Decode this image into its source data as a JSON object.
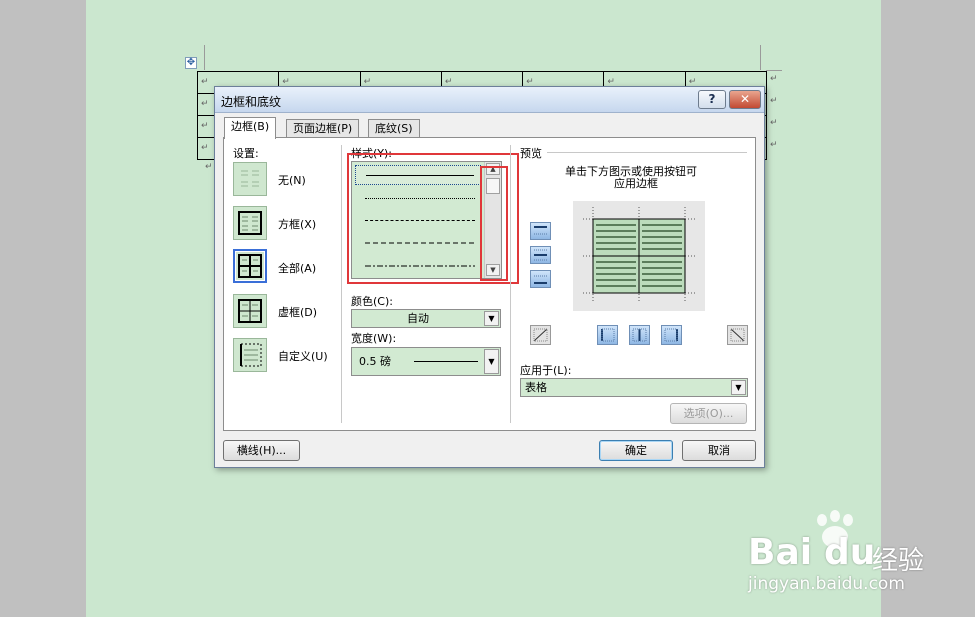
{
  "document": {
    "paragraph_mark": "↵",
    "table_move_handle": "✥"
  },
  "dialog": {
    "title": "边框和底纹",
    "help_label": "?",
    "close_label": "✕",
    "tabs": [
      {
        "label": "边框(B)",
        "active": true
      },
      {
        "label": "页面边框(P)",
        "active": false
      },
      {
        "label": "底纹(S)",
        "active": false
      }
    ],
    "settings": {
      "label": "设置:",
      "items": [
        {
          "label": "无(N)",
          "icon": "border-none-icon",
          "selected": false
        },
        {
          "label": "方框(X)",
          "icon": "border-box-icon",
          "selected": false
        },
        {
          "label": "全部(A)",
          "icon": "border-all-icon",
          "selected": true
        },
        {
          "label": "虚框(D)",
          "icon": "border-grid-icon",
          "selected": false
        },
        {
          "label": "自定义(U)",
          "icon": "border-custom-icon",
          "selected": false
        }
      ]
    },
    "style": {
      "label": "样式(Y):",
      "items": [
        "solid",
        "dotted-fine",
        "dashed-fine",
        "dashed",
        "dash-dot"
      ],
      "selected_index": 0
    },
    "color": {
      "label": "颜色(C):",
      "value": "自动"
    },
    "width": {
      "label": "宽度(W):",
      "value": "0.5 磅"
    },
    "preview": {
      "label": "预览",
      "hint_line1": "单击下方图示或使用按钮可",
      "hint_line2": "应用边框"
    },
    "apply_to": {
      "label": "应用于(L):",
      "value": "表格"
    },
    "options_button": "选项(O)...",
    "horizontal_line_button": "横线(H)...",
    "ok_button": "确定",
    "cancel_button": "取消",
    "highlight_color": "#e0373a"
  },
  "watermark": {
    "brand": "Bai",
    "brand_suffix": "du",
    "product": "经验",
    "url": "jingyan.baidu.com"
  }
}
